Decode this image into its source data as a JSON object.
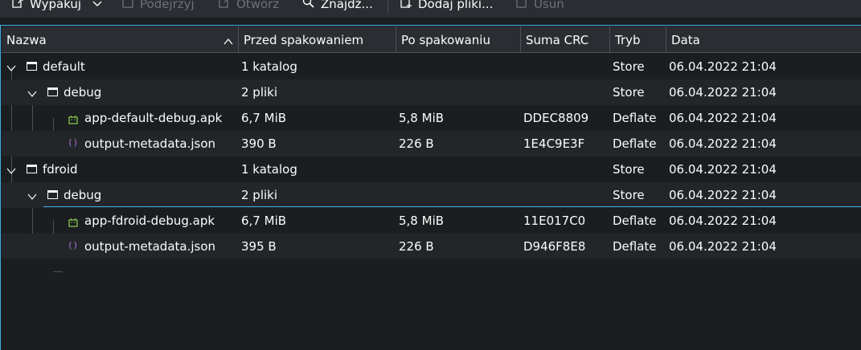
{
  "toolbar": {
    "extract": "Wypakuj",
    "preview": "Podejrzyj",
    "open": "Otwórz",
    "find": "Znajdź...",
    "add_files": "Dodaj pliki...",
    "delete": "Usuń"
  },
  "columns": {
    "name": "Nazwa",
    "size": "Przed spakowaniem",
    "packed": "Po spakowaniu",
    "crc": "Suma CRC",
    "method": "Tryb",
    "date": "Data"
  },
  "rows": [
    {
      "name": "default",
      "size": "1 katalog",
      "packed": "",
      "crc": "",
      "method": "Store",
      "date": "06.04.2022 21:04",
      "kind": "folder"
    },
    {
      "name": "debug",
      "size": "2 pliki",
      "packed": "",
      "crc": "",
      "method": "Store",
      "date": "06.04.2022 21:04",
      "kind": "folder"
    },
    {
      "name": "app-default-debug.apk",
      "size": "6,7 MiB",
      "packed": "5,8 MiB",
      "crc": "DDEC8809",
      "method": "Deflate",
      "date": "06.04.2022 21:04",
      "kind": "apk"
    },
    {
      "name": "output-metadata.json",
      "size": "390 B",
      "packed": "226 B",
      "crc": "1E4C9E3F",
      "method": "Deflate",
      "date": "06.04.2022 21:04",
      "kind": "json"
    },
    {
      "name": "fdroid",
      "size": "1 katalog",
      "packed": "",
      "crc": "",
      "method": "Store",
      "date": "06.04.2022 21:04",
      "kind": "folder"
    },
    {
      "name": "debug",
      "size": "2 pliki",
      "packed": "",
      "crc": "",
      "method": "Store",
      "date": "06.04.2022 21:04",
      "kind": "folder"
    },
    {
      "name": "app-fdroid-debug.apk",
      "size": "6,7 MiB",
      "packed": "5,8 MiB",
      "crc": "11E017C0",
      "method": "Deflate",
      "date": "06.04.2022 21:04",
      "kind": "apk"
    },
    {
      "name": "output-metadata.json",
      "size": "395 B",
      "packed": "226 B",
      "crc": "D946F8E8",
      "method": "Deflate",
      "date": "06.04.2022 21:04",
      "kind": "json"
    }
  ],
  "icons": {
    "folder": "folder-icon",
    "apk": "android-package-icon",
    "json": "json-file-icon"
  },
  "colors": {
    "accent": "#3daee9",
    "apk_green": "#8fd14f",
    "json_purple": "#b070d8"
  }
}
